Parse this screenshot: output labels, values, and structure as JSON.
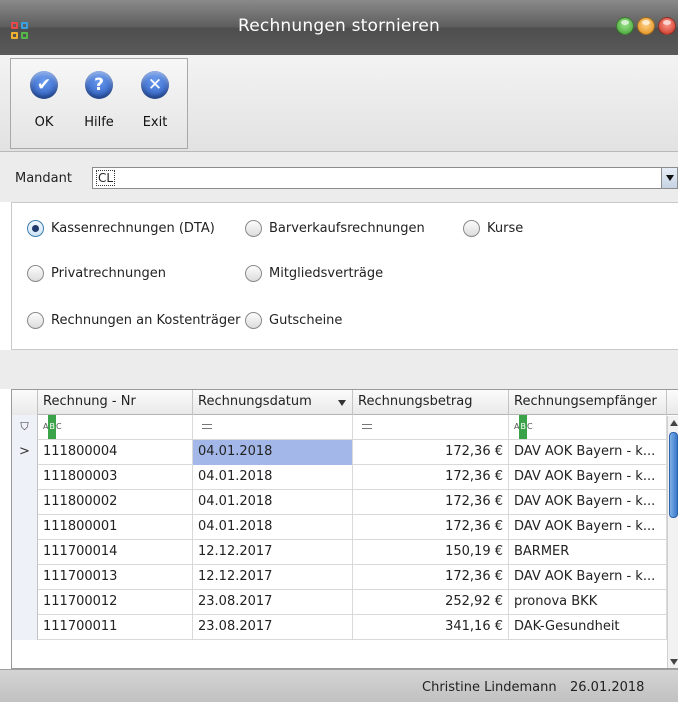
{
  "window": {
    "title": "Rechnungen stornieren",
    "controls": {
      "minimize_color": "#5cc04a",
      "maximize_color": "#f2a530",
      "close_color": "#e2473a"
    }
  },
  "toolbar": {
    "buttons": [
      {
        "label": "OK",
        "icon": "check-icon",
        "color": "#2f63c7"
      },
      {
        "label": "Hilfe",
        "icon": "help-icon",
        "color": "#2f63c7"
      },
      {
        "label": "Exit",
        "icon": "close-icon",
        "color": "#2f63c7"
      }
    ]
  },
  "mandant": {
    "label": "Mandant",
    "value": "CL"
  },
  "invoice_types": {
    "selected": "Kassenrechnungen (DTA)",
    "options": [
      {
        "label": "Kassenrechnungen (DTA)",
        "checked": true
      },
      {
        "label": "Barverkaufsrechnungen",
        "checked": false
      },
      {
        "label": "Kurse",
        "checked": false
      },
      {
        "label": "Privatrechnungen",
        "checked": false
      },
      {
        "label": "Mitgliedsverträge",
        "checked": false
      },
      {
        "label": "Rechnungen an Kostenträger",
        "checked": false
      },
      {
        "label": "Gutscheine",
        "checked": false
      }
    ]
  },
  "grid": {
    "columns": [
      "Rechnung - Nr",
      "Rechnungsdatum",
      "Rechnungsbetrag",
      "Rechnungsempfänger"
    ],
    "sorted_column": "Rechnungsdatum",
    "sort_direction": "descending",
    "filter_icons": {
      "text": "ABC",
      "equals": "="
    },
    "current_row_marker": ">",
    "rows": [
      {
        "nr": "111800004",
        "datum": "04.01.2018",
        "betrag": "172,36 €",
        "empfaenger": "DAV AOK Bayern - k...",
        "selected": true
      },
      {
        "nr": "111800003",
        "datum": "04.01.2018",
        "betrag": "172,36 €",
        "empfaenger": "DAV AOK Bayern - k...",
        "selected": false
      },
      {
        "nr": "111800002",
        "datum": "04.01.2018",
        "betrag": "172,36 €",
        "empfaenger": "DAV AOK Bayern - k...",
        "selected": false
      },
      {
        "nr": "111800001",
        "datum": "04.01.2018",
        "betrag": "172,36 €",
        "empfaenger": "DAV AOK Bayern - k...",
        "selected": false
      },
      {
        "nr": "111700014",
        "datum": "12.12.2017",
        "betrag": "150,19 €",
        "empfaenger": "BARMER",
        "selected": false
      },
      {
        "nr": "111700013",
        "datum": "12.12.2017",
        "betrag": "172,36 €",
        "empfaenger": "DAV AOK Bayern - k...",
        "selected": false
      },
      {
        "nr": "111700012",
        "datum": "23.08.2017",
        "betrag": "252,92 €",
        "empfaenger": "pronova BKK",
        "selected": false
      },
      {
        "nr": "111700011",
        "datum": "23.08.2017",
        "betrag": "341,16 €",
        "empfaenger": "DAK-Gesundheit",
        "selected": false
      }
    ]
  },
  "status": {
    "user": "Christine Lindemann",
    "date": "26.01.2018"
  }
}
